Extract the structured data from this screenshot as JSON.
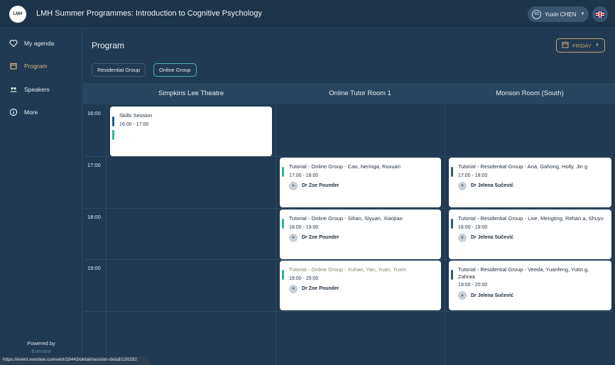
{
  "header": {
    "logo_text": "LMH",
    "title": "LMH Summer Programmes: Introduction to Cognitive Psychology",
    "user_initials": "YC",
    "user_name": "Yuxin CHEN",
    "lang_icon": "uk-flag-icon"
  },
  "sidebar": {
    "items": [
      {
        "label": "My agenda",
        "icon": "heart-icon"
      },
      {
        "label": "Program",
        "icon": "calendar-icon"
      },
      {
        "label": "Speakers",
        "icon": "people-icon"
      },
      {
        "label": "More",
        "icon": "info-icon"
      }
    ],
    "powered_by": "Powered by",
    "brand": "Eventee"
  },
  "main": {
    "page_title": "Program",
    "day_selector": "FRIDAY",
    "filters": [
      "Residential Group",
      "Online Group"
    ],
    "active_filter": "Online Group",
    "columns": [
      "Simpkins Lee Theatre",
      "Online Tutor Room 1",
      "Monson Room (South)"
    ],
    "times": [
      "16:00",
      "17:00",
      "18:00",
      "19:00"
    ],
    "sessions": [
      {
        "title": "Skills Session",
        "time": "16:00 - 17:00",
        "speaker": ""
      },
      {
        "title": "Tutorial - Online Group - Cao, Neringa, Ruxuan",
        "time": "17:00 - 18:00",
        "speaker": "Dr Zoe Pounder"
      },
      {
        "title": "Tutorial - Residential Group - Ana, Gahong, Holly, Jin g",
        "time": "17:00 - 18:00",
        "speaker": "Dr Jelena Sučević"
      },
      {
        "title": "Tutorial - Online Group - Sihan, Siyuan, Xiaojiao",
        "time": "18:00 - 19:00",
        "speaker": "Dr Zoe Pounder"
      },
      {
        "title": "Tutorial - Residential Group - Live, Mengting, Rehan a, Shuyu",
        "time": "18:00 - 19:00",
        "speaker": "Dr Jelena Sučević"
      },
      {
        "title": "Tutorial - Online Group - Xuhao, Yan, Yuan, Yuxin",
        "time": "19:00 - 20:00",
        "speaker": "Dr Zoe Pounder"
      },
      {
        "title": "Tutorial - Residential Group - Veeda, Yuanfeng, Yutin g, Zahraa",
        "time": "19:00 - 20:00",
        "speaker": "Dr Jelena Sučević"
      }
    ]
  },
  "statusbar": {
    "url": "https://event.eventee.co/event/18443/detail/session-detail/130292"
  },
  "colors": {
    "background": "#1f3a52",
    "accent_gold": "#c8a679",
    "accent_teal": "#4fb3a6",
    "tag_green": "#2fb59a",
    "tag_blue": "#2e5a7a"
  }
}
